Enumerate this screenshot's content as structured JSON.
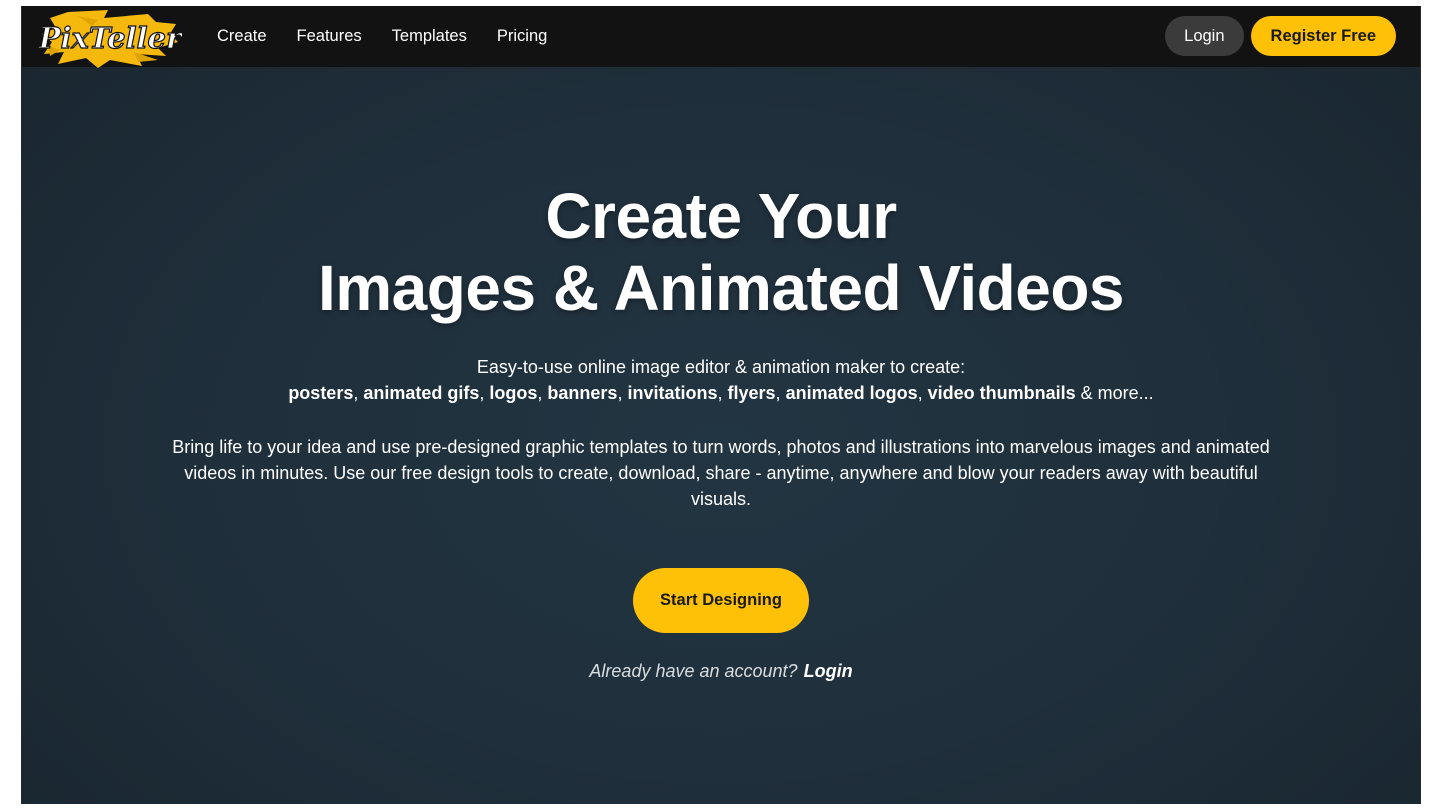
{
  "brand": {
    "logo_text": "PixTeller",
    "accent_color": "#ffc107",
    "nav_background": "#121212",
    "hero_background": "#1f2f3b"
  },
  "nav": {
    "links": [
      "Create",
      "Features",
      "Templates",
      "Pricing"
    ],
    "login_label": "Login",
    "register_label": "Register Free"
  },
  "hero": {
    "title_line1": "Create Your",
    "title_line2": "Images & Animated Videos",
    "subtitle": "Easy-to-use online image editor & animation maker to create:",
    "types": [
      "posters",
      "animated gifs",
      "logos",
      "banners",
      "invitations",
      "flyers",
      "animated logos",
      "video thumbnails"
    ],
    "types_suffix": "& more...",
    "description": "Bring life to your idea and use pre-designed graphic templates to turn words, photos and illustrations into marvelous images and animated videos in minutes. Use our free design tools to create, download, share - anytime, anywhere and blow your readers away with beautiful visuals.",
    "cta_label": "Start Designing",
    "already_text": "Already have an account?",
    "already_login_label": "Login"
  }
}
